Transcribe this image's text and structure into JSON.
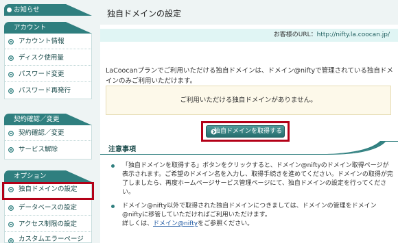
{
  "sidebar": {
    "news": {
      "label": "お知らせ"
    },
    "sections": [
      {
        "title": "アカウント",
        "items": [
          {
            "label": "アカウント情報"
          },
          {
            "label": "ディスク使用量"
          },
          {
            "label": "パスワード変更"
          },
          {
            "label": "パスワード再発行"
          }
        ]
      },
      {
        "title": "契約確認／変更",
        "items": [
          {
            "label": "契約確認／変更"
          },
          {
            "label": "サービス解除"
          }
        ]
      },
      {
        "title": "オプション",
        "items": [
          {
            "label": "独自ドメインの設定",
            "active": true
          },
          {
            "label": "データベースの設定"
          },
          {
            "label": "アクセス制限の設定"
          },
          {
            "label": "カスタムエラーページ"
          }
        ]
      }
    ]
  },
  "main": {
    "title": "独自ドメインの設定",
    "url_label": "お客様のURL：",
    "url_value": "http://nifty.la.coocan.jp/",
    "intro": "LaCoocanプランでご利用いただける独自ドメインは、ドメイン@niftyで管理されている独自ドメインのみご利用いただけます。",
    "no_domain_message": "ご利用いただける独自ドメインがありません。",
    "acquire_button": "独自ドメインを取得する",
    "caution_title": "注意事項",
    "caution_items": [
      {
        "text": "「独自ドメインを取得する」ボタンをクリックすると、ドメイン@niftyのドメイン取得ページが表示されます。ご希望のドメイン名を入力し、取得手続きを進めてください。ドメインの取得が完了しましたら、再度ホームページサービス管理ページにて、独自ドメインの設定を行ってください。"
      },
      {
        "text": "ドメイン@nifty以外で取得された独自ドメインにつきましては、ドメインの管理をドメイン@niftyに移管していただければご利用いただけます。",
        "more_prefix": "詳しくは、",
        "link": "ドメイン@nifty",
        "more_suffix": "をご参照ください。"
      }
    ]
  },
  "colors": {
    "accent": "#2f7f7f",
    "highlight_border": "#b30017",
    "url_bar_bg": "#e0f5f4",
    "notice_bg": "#fdf9ea"
  },
  "icons": {
    "news": "bullet-icon",
    "menu_item": "link-arrow-icon",
    "acquire": "arrow-icon"
  }
}
